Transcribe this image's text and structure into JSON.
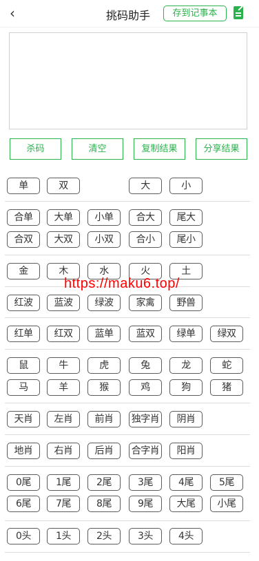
{
  "header": {
    "back_icon": "chevron-left-icon",
    "title": "挑码助手",
    "save_label": "存到记事本",
    "note_icon": "notepad-icon",
    "accent": "#2bb24c"
  },
  "input": {
    "value": ""
  },
  "actions": [
    {
      "id": "kill",
      "label": "杀码"
    },
    {
      "id": "clear",
      "label": "清空"
    },
    {
      "id": "copy",
      "label": "复制结果"
    },
    {
      "id": "share",
      "label": "分享结果"
    }
  ],
  "groups": [
    [
      [
        "单",
        "双",
        null,
        "大",
        "小"
      ]
    ],
    [
      [
        "合单",
        "大单",
        "小单",
        "合大",
        "尾大"
      ],
      [
        "合双",
        "大双",
        "小双",
        "合小",
        "尾小"
      ]
    ],
    [
      [
        "金",
        "木",
        "水",
        "火",
        "土"
      ]
    ],
    [
      [
        "红波",
        "蓝波",
        "绿波",
        "家禽",
        "野兽"
      ]
    ],
    [
      [
        "红单",
        "红双",
        "蓝单",
        "蓝双",
        "绿单",
        "绿双"
      ]
    ],
    [
      [
        "鼠",
        "牛",
        "虎",
        "兔",
        "龙",
        "蛇"
      ],
      [
        "马",
        "羊",
        "猴",
        "鸡",
        "狗",
        "猪"
      ]
    ],
    [
      [
        "天肖",
        "左肖",
        "前肖",
        "独字肖",
        "阴肖"
      ]
    ],
    [
      [
        "地肖",
        "右肖",
        "后肖",
        "合字肖",
        "阳肖"
      ]
    ],
    [
      [
        "0尾",
        "1尾",
        "2尾",
        "3尾",
        "4尾",
        "5尾"
      ],
      [
        "6尾",
        "7尾",
        "8尾",
        "9尾",
        "大尾",
        "小尾"
      ]
    ],
    [
      [
        "0头",
        "1头",
        "2头",
        "3头",
        "4头"
      ]
    ]
  ],
  "watermark": "https://maku6.top/"
}
